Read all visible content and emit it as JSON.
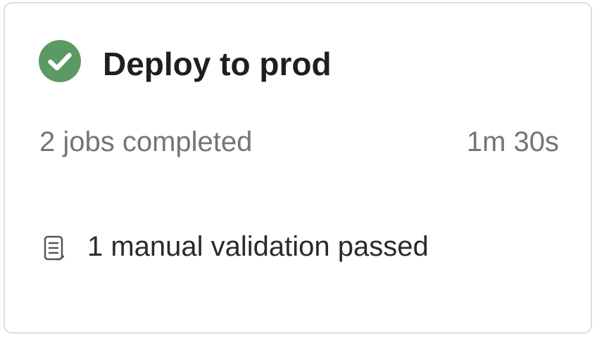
{
  "card": {
    "status": "success",
    "status_icon": "check-circle-icon",
    "status_color": "#5b9a63",
    "title": "Deploy to prod",
    "jobs_summary": "2 jobs completed",
    "duration": "1m 30s",
    "validation": {
      "icon": "clipboard-list-icon",
      "text": "1 manual validation passed"
    }
  }
}
